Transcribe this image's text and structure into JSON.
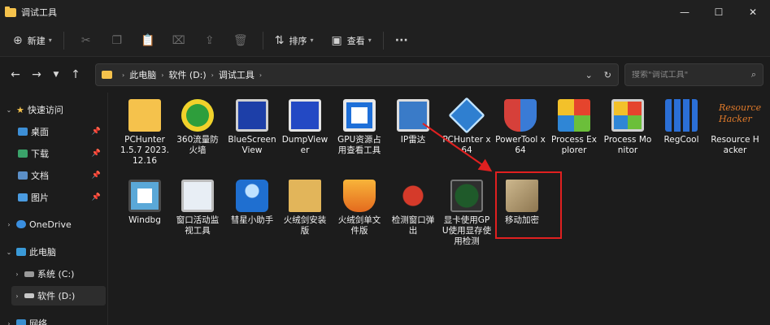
{
  "window": {
    "title": "调试工具",
    "controls": [
      "—",
      "☐",
      "✕"
    ]
  },
  "toolbar": {
    "new_label": "新建",
    "sort_label": "排序",
    "view_label": "查看",
    "more_label": "···"
  },
  "address": {
    "crumbs": [
      "此电脑",
      "软件 (D:)",
      "调试工具"
    ],
    "search_placeholder": "搜索\"调试工具\""
  },
  "sidebar": {
    "items": [
      {
        "label": "快速访问",
        "chevron": "v",
        "icon": "star-icon"
      },
      {
        "label": "桌面",
        "icon": "desktop-icon",
        "pinned": true
      },
      {
        "label": "下载",
        "icon": "download-icon",
        "pinned": true
      },
      {
        "label": "文档",
        "icon": "documents-icon",
        "pinned": true
      },
      {
        "label": "图片",
        "icon": "pictures-icon",
        "pinned": true
      },
      {
        "label": "OneDrive",
        "chevron": ">",
        "icon": "cloud-icon"
      },
      {
        "label": "此电脑",
        "chevron": "v",
        "icon": "pc-icon"
      },
      {
        "label": "系统 (C:)",
        "chevron": ">",
        "icon": "drive-icon"
      },
      {
        "label": "软件 (D:)",
        "chevron": ">",
        "icon": "drive-icon"
      },
      {
        "label": "网络",
        "chevron": ">",
        "icon": "network-icon"
      }
    ]
  },
  "files": [
    {
      "label": "PCHunter 1.5.7 2023.12.16",
      "icon": "folder-icon"
    },
    {
      "label": "360流量防火墙",
      "icon": "firewall-icon"
    },
    {
      "label": "BlueScreenView",
      "icon": "bluescreen-icon"
    },
    {
      "label": "DumpViewer",
      "icon": "dump-icon"
    },
    {
      "label": "GPU资源占用查看工具",
      "icon": "gpu-icon"
    },
    {
      "label": "IP雷达",
      "icon": "ip-radar-icon"
    },
    {
      "label": "PCHunter x64",
      "icon": "pchunter-icon"
    },
    {
      "label": "PowerTool x64",
      "icon": "powertool-icon"
    },
    {
      "label": "Process Explorer",
      "icon": "process-explorer-icon"
    },
    {
      "label": "Process Monitor",
      "icon": "process-monitor-icon"
    },
    {
      "label": "RegCool",
      "icon": "regcool-icon"
    },
    {
      "label": "Resource Hacker",
      "icon": "resource-hacker-icon",
      "logo_text": "Resource Hacker"
    },
    {
      "label": "Windbg",
      "icon": "windbg-icon"
    },
    {
      "label": "窗口活动监视工具",
      "icon": "window-monitor-icon"
    },
    {
      "label": "彗星小助手",
      "icon": "comet-icon"
    },
    {
      "label": "火绒剑安装版",
      "icon": "installer-icon"
    },
    {
      "label": "火绒剑单文件版",
      "icon": "huorong-icon"
    },
    {
      "label": "检测窗口弹出",
      "icon": "ladybug-icon"
    },
    {
      "label": "显卡使用GPU使用显存使用检测",
      "icon": "gpu-monitor-icon"
    },
    {
      "label": "移动加密",
      "icon": "encrypt-drive-icon"
    }
  ],
  "colors": {
    "highlight": "#e02020",
    "folder": "#f5c24c"
  }
}
